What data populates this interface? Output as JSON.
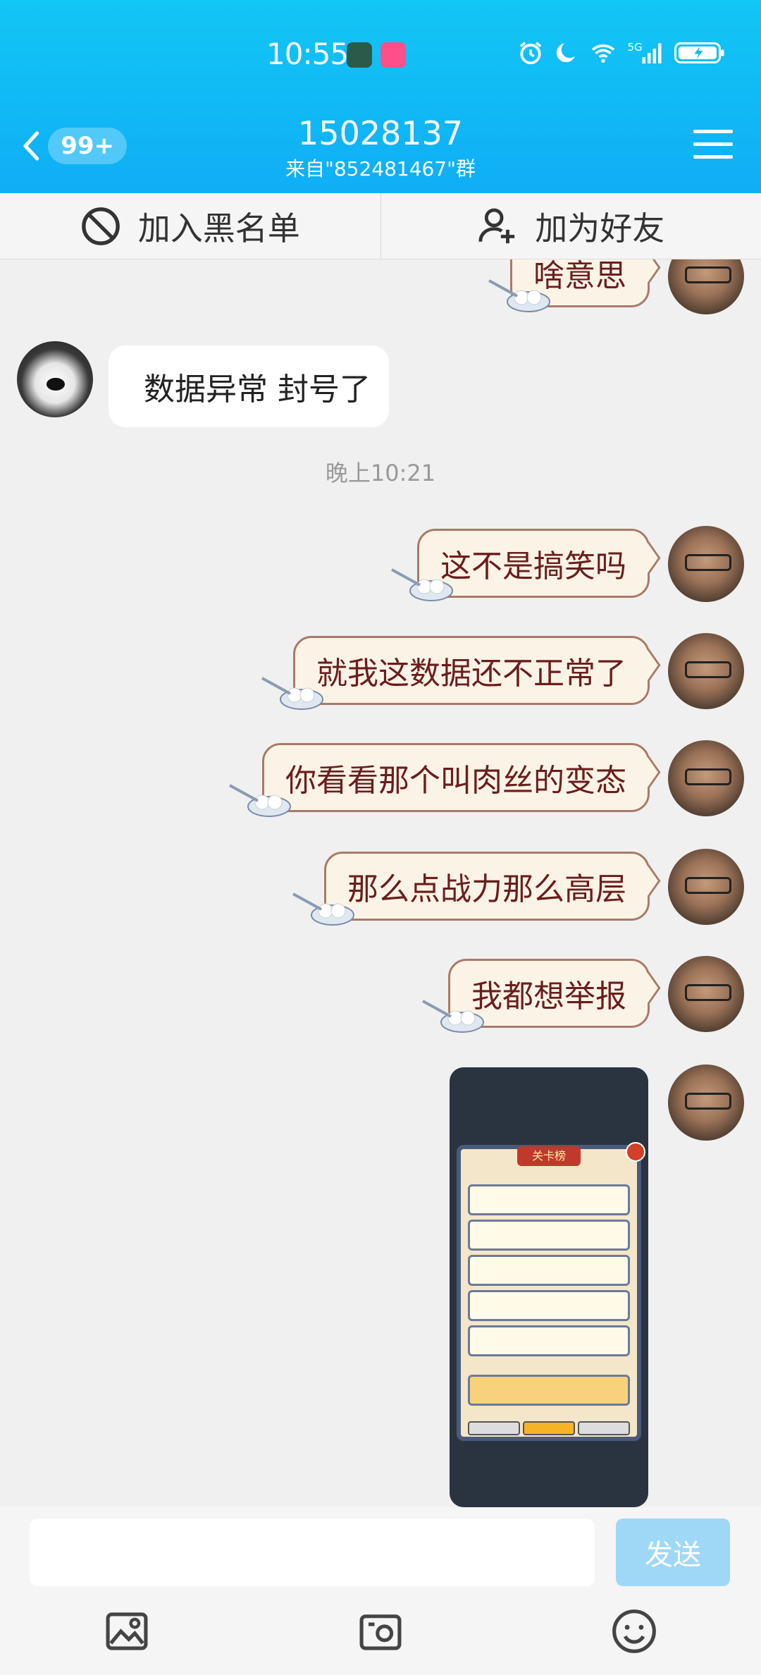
{
  "status_bar": {
    "time": "10:55",
    "app_icon_1_color": "#2b5a4a",
    "app_icon_2_color": "#ff4f8a"
  },
  "header": {
    "badge": "99+",
    "title": "15028137",
    "subtitle": "来自\"852481467\"群"
  },
  "actions": {
    "blacklist": "加入黑名单",
    "add_friend": "加为好友"
  },
  "messages": {
    "partial_top": "啥意思",
    "left_1": "数据异常 封号了",
    "timestamp": "晚上10:21",
    "right_1": "这不是搞笑吗",
    "right_2": "就我这数据还不正常了",
    "right_3": "你看看那个叫肉丝的变态",
    "right_4": "那么点战力那么高层",
    "right_5": "我都想举报"
  },
  "game_screenshot": {
    "title": "关卡榜"
  },
  "input": {
    "placeholder": "",
    "send_label": "发送"
  },
  "colors": {
    "header_bg": "#12c6f5",
    "bubble_bg": "#fbf4e6",
    "bubble_border": "#a97a68",
    "bubble_text": "#6b1d1d",
    "send_bg": "#9fd8f7"
  }
}
